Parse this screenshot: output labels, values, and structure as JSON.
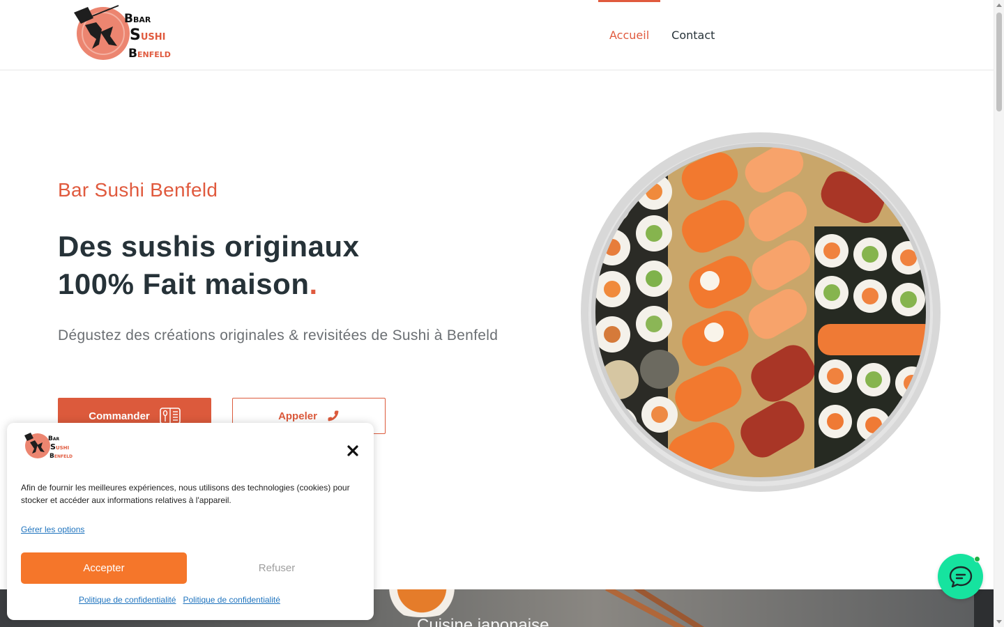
{
  "header": {
    "logo": {
      "line1": "BAR",
      "line2": "SUSHI",
      "line3": "BENFELD"
    },
    "nav": [
      {
        "label": "Accueil",
        "active": true
      },
      {
        "label": "Contact",
        "active": false
      }
    ]
  },
  "hero": {
    "kicker": "Bar Sushi Benfeld",
    "headline_line1": "Des sushis originaux",
    "headline_line2": "100% Fait maison",
    "headline_dot": ".",
    "lead": "Dégustez des créations originales & revisitées de Sushi à Benfeld",
    "order_button": "Commander",
    "call_button": "Appeler"
  },
  "strip": {
    "title": "Cuisine japonaise"
  },
  "cookie": {
    "text": "Afin de fournir les meilleures expériences, nous utilisons des technologies (cookies) pour stocker et accéder aux informations relatives à l'appareil.",
    "manage": "Gérer les options",
    "accept": "Accepter",
    "refuse": "Refuser",
    "links": [
      "Politique de confidentialité",
      "Politique de confidentialité"
    ]
  },
  "colors": {
    "accent": "#dc5a3c",
    "cookie_accept": "#f5762a",
    "chat": "#16e39f"
  },
  "icons": {
    "order": "menu-icon",
    "call": "phone-icon",
    "close": "close-icon",
    "chat": "chat-icon"
  }
}
